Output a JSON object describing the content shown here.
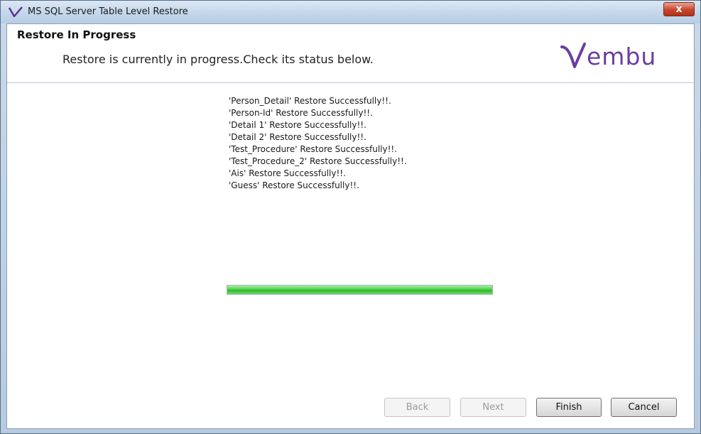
{
  "window": {
    "title": "MS SQL Server Table Level Restore",
    "close_label": "x"
  },
  "header": {
    "title": "Restore In Progress",
    "subtitle": "Restore is currently in progress.Check its status below.",
    "brand": "embu"
  },
  "log": [
    "'Person_Detail' Restore Successfully!!.",
    "'Person-Id' Restore Successfully!!.",
    "'Detail 1' Restore Successfully!!.",
    "'Detail 2' Restore Successfully!!.",
    "'Test_Procedure' Restore Successfully!!.",
    "'Test_Procedure_2' Restore Successfully!!.",
    "'Ais' Restore Successfully!!.",
    "'Guess' Restore Successfully!!."
  ],
  "progress": {
    "fraction": 1.0
  },
  "buttons": {
    "back": "Back",
    "next": "Next",
    "finish": "Finish",
    "cancel": "Cancel"
  },
  "colors": {
    "brand_purple": "#6a3ea1",
    "progress_green": "#52d04d"
  },
  "icons": {
    "app": "vembu-v-icon",
    "close": "close-icon"
  }
}
